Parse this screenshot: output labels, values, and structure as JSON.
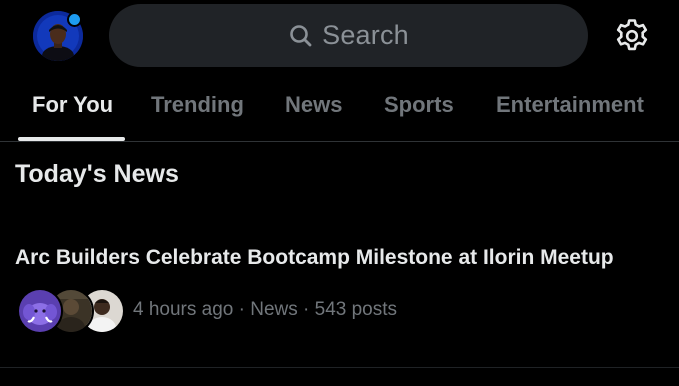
{
  "header": {
    "search_placeholder": "Search",
    "avatar_icon": "user-avatar",
    "notification_dot_color": "#1d9bf0",
    "settings_icon": "gear-icon"
  },
  "tabs": [
    {
      "label": "For You",
      "active": true
    },
    {
      "label": "Trending",
      "active": false
    },
    {
      "label": "News",
      "active": false
    },
    {
      "label": "Sports",
      "active": false
    },
    {
      "label": "Entertainment",
      "active": false
    }
  ],
  "section": {
    "title": "Today's News"
  },
  "story": {
    "headline": "Arc Builders Celebrate Bootcamp Milestone at Ilorin Meetup",
    "time": "4 hours ago",
    "category": "News",
    "posts": "543 posts",
    "meta": "4 hours ago · News · 543 posts"
  },
  "colors": {
    "background": "#000000",
    "search_bg": "#202327",
    "text_primary": "#e7e9ea",
    "text_secondary": "#71767b",
    "accent": "#1d9bf0"
  }
}
